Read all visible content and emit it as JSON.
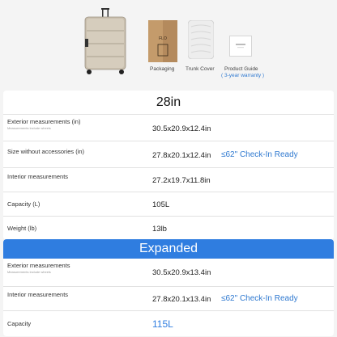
{
  "accessories": {
    "packaging": "Packaging",
    "trunk_cover": "Trunk Cover",
    "product_guide": "Product Guide",
    "warranty": "( 3-year warranty )"
  },
  "standard": {
    "size": "28in",
    "rows": [
      {
        "label": "Exterior measurements (in)",
        "note": "Measurements include wheels",
        "value": "30.5x20.9x12.4in"
      },
      {
        "label": "Size without accessories (in)",
        "value": "27.8x20.1x12.4in",
        "checkin": "≤62\" Check-In Ready"
      },
      {
        "label": "Interior measurements",
        "value": "27.2x19.7x11.8in"
      },
      {
        "label": "Capacity (L)",
        "value": "105L"
      },
      {
        "label": "Weight (lb)",
        "value": "13lb"
      }
    ]
  },
  "expanded": {
    "title": "Expanded",
    "rows": [
      {
        "label": "Exterior measurements",
        "note": "Measurements include wheels",
        "value": "30.5x20.9x13.4in"
      },
      {
        "label": "Interior measurements",
        "value": "27.8x20.1x13.4in",
        "checkin": "≤62\" Check-In Ready"
      },
      {
        "label": "Capacity",
        "value": "115L"
      }
    ]
  },
  "colors": {
    "accent": "#2f7de0",
    "suitcase": "#c9bfae"
  }
}
